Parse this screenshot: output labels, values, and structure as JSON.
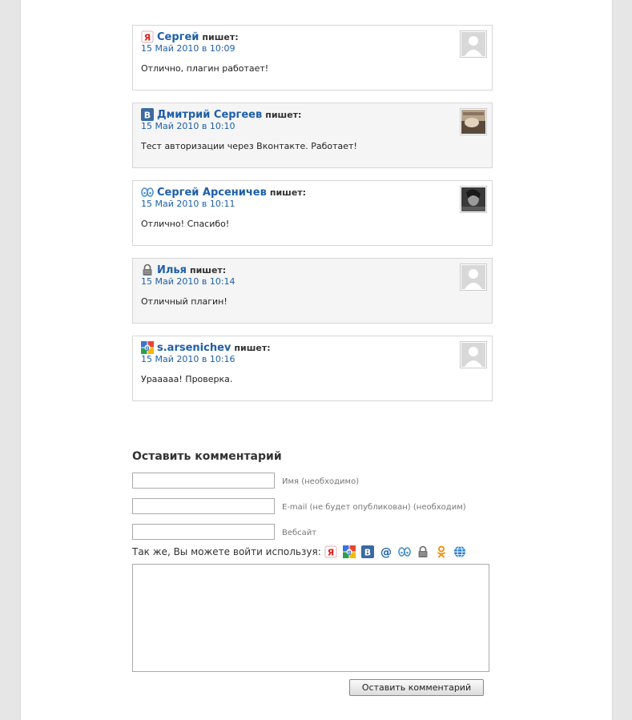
{
  "comments": [
    {
      "author": "Сергей",
      "says": "пишет:",
      "date": "15 Май 2010 в 10:09",
      "text": "Отлично, плагин работает!",
      "provider_icon": "yandex-icon",
      "avatar": "default"
    },
    {
      "author": "Дмитрий Сергеев",
      "says": "пишет:",
      "date": "15 Май 2010 в 10:10",
      "text": "Тест авторизации через Вконтакте. Работает!",
      "provider_icon": "vkontakte-icon",
      "avatar": "photo"
    },
    {
      "author": "Сергей Арсеничев",
      "says": "пишет:",
      "date": "15 Май 2010 в 10:11",
      "text": "Отлично! Спасибо!",
      "provider_icon": "livejournal-icon",
      "avatar": "photo-bw"
    },
    {
      "author": "Илья",
      "says": "пишет:",
      "date": "15 Май 2010 в 10:14",
      "text": "Отличный плагин!",
      "provider_icon": "lock-icon",
      "avatar": "default"
    },
    {
      "author": "s.arsenichev",
      "says": "пишет:",
      "date": "15 Май 2010 в 10:16",
      "text": "Урааааа! Проверка.",
      "provider_icon": "google-icon",
      "avatar": "default"
    }
  ],
  "form": {
    "title": "Оставить комментарий",
    "name_label": "Имя (необходимо)",
    "email_label": "E-mail (не будет опубликован) (необходим)",
    "website_label": "Вебсайт",
    "login_text": "Так же, Вы можете войти используя:",
    "login_providers": [
      "yandex-icon",
      "google-icon",
      "vkontakte-icon",
      "mailru-icon",
      "livejournal-icon",
      "openid-lock-icon",
      "odnoklassniki-icon",
      "webmoney-icon"
    ],
    "submit_label": "Оставить комментарий"
  },
  "colors": {
    "link": "#1e5fa8",
    "border": "#d6d6d6",
    "alt_bg": "#f5f5f5",
    "page_bg": "#e6e6e6"
  }
}
